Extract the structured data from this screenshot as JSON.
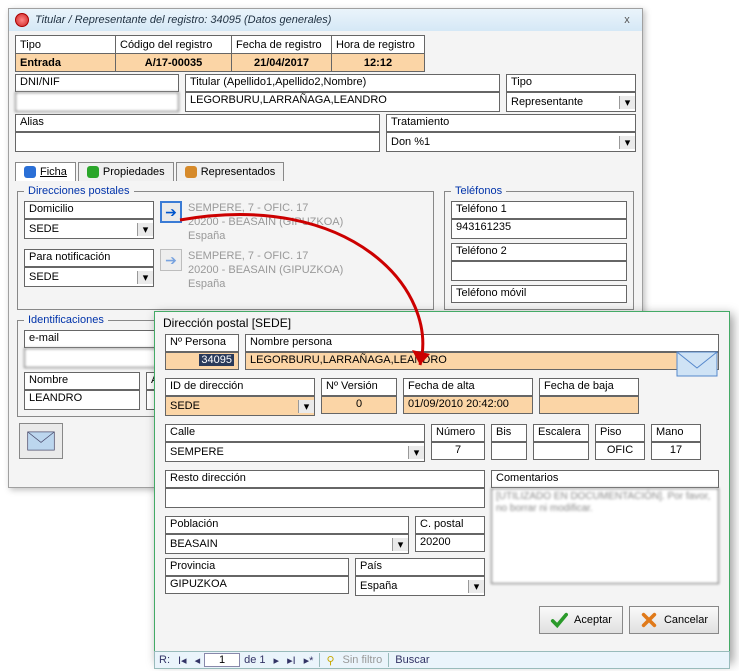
{
  "win1": {
    "title": "Titular / Representante del registro: 34095 (Datos generales)",
    "close": "x",
    "headers": {
      "tipo": "Tipo",
      "codigo": "Código del registro",
      "fecha_reg": "Fecha de registro",
      "hora_reg": "Hora de registro",
      "tipo_val": "Entrada",
      "codigo_val": "A/17-00035",
      "fecha_val": "21/04/2017",
      "hora_val": "12:12",
      "dni": "DNI/NIF",
      "dni_val": "",
      "titular_hdr": "Titular (Apellido1,Apellido2,Nombre)",
      "titular_val": "LEGORBURU,LARRAÑAGA,LEANDRO",
      "tipo2_hdr": "Tipo",
      "tipo2_val": "Representante",
      "alias_hdr": "Alias",
      "tratamiento_hdr": "Tratamiento",
      "tratamiento_val": "Don %1"
    },
    "tabs": {
      "ficha": "Ficha",
      "propiedades": "Propiedades",
      "representados": "Representados"
    },
    "direcciones": {
      "legend": "Direcciones postales",
      "domicilio_hdr": "Domicilio",
      "domicilio_val": "SEDE",
      "notif_hdr": "Para notificación",
      "notif_val": "SEDE",
      "addr1": "SEMPERE, 7 - OFIC. 17",
      "addr2": "20200 - BEASAIN (GIPUZKOA)",
      "addr3": "España"
    },
    "telefonos": {
      "legend": "Teléfonos",
      "tel1_hdr": "Teléfono 1",
      "tel1_val": "943161235",
      "tel2_hdr": "Teléfono 2",
      "movil_hdr": "Teléfono móvil"
    },
    "ident": {
      "legend": "Identificaciones",
      "email_hdr": "e-mail",
      "email_val": "",
      "nombre_hdr": "Nombre",
      "nombre_val": "LEANDRO",
      "ap_hdr": "Ap"
    }
  },
  "win2": {
    "title": "Dirección postal [SEDE]",
    "npersona_hdr": "Nº Persona",
    "npersona_val": "34095",
    "nombrep_hdr": "Nombre persona",
    "nombrep_val": "LEGORBURU,LARRAÑAGA,LEANDRO",
    "iddir_hdr": "ID de dirección",
    "iddir_val": "SEDE",
    "nver_hdr": "Nº Versión",
    "nver_val": "0",
    "falta_hdr": "Fecha de alta",
    "falta_val": "01/09/2010 20:42:00",
    "fbaja_hdr": "Fecha de baja",
    "calle_hdr": "Calle",
    "calle_val": "SEMPERE",
    "numero_hdr": "Número",
    "numero_val": "7",
    "bis_hdr": "Bis",
    "escalera_hdr": "Escalera",
    "piso_hdr": "Piso",
    "piso_val": "OFIC",
    "mano_hdr": "Mano",
    "mano_val": "17",
    "resto_hdr": "Resto dirección",
    "comentarios_hdr": "Comentarios",
    "comentarios_val": "[UTILIZADO EN DOCUMENTACIÓN]. Por favor, no borrar ni modificar.",
    "poblacion_hdr": "Población",
    "poblacion_val": "BEASAIN",
    "cpostal_hdr": "C. postal",
    "cpostal_val": "20200",
    "provincia_hdr": "Provincia",
    "provincia_val": "GIPUZKOA",
    "pais_hdr": "País",
    "pais_val": "España",
    "aceptar": "Aceptar",
    "cancelar": "Cancelar"
  },
  "nav": {
    "label_r": "R:",
    "page": "1",
    "of": "de 1",
    "sinfiltro": "Sin filtro",
    "buscar": "Buscar"
  }
}
